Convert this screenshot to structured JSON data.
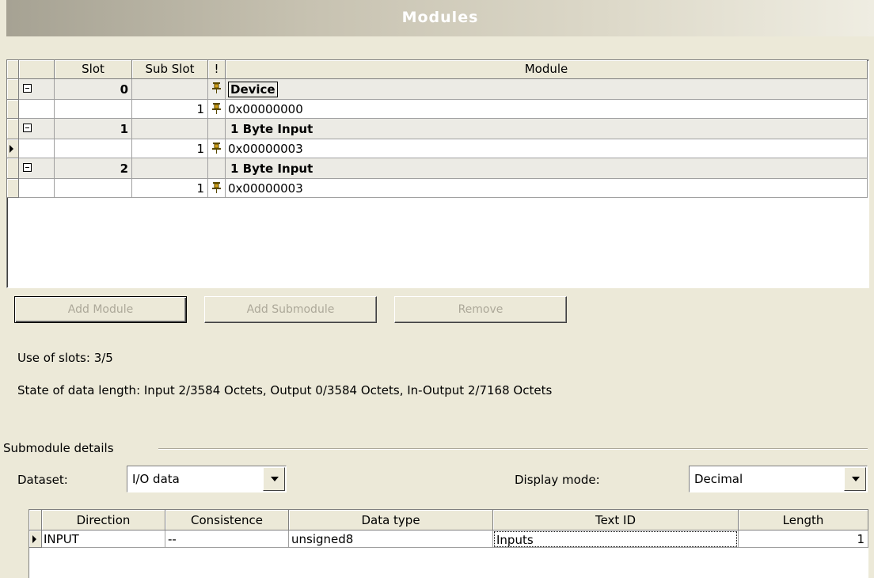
{
  "window": {
    "title": "Modules"
  },
  "modules_grid": {
    "columns": {
      "slot": "Slot",
      "sub_slot": "Sub Slot",
      "flag": "!",
      "module": "Module"
    },
    "rows": [
      {
        "type": "module",
        "slot": "0",
        "sub_slot": "",
        "pinned": true,
        "module": "Device"
      },
      {
        "type": "sub",
        "slot": "",
        "sub_slot": "1",
        "pinned": true,
        "module": "0x00000000"
      },
      {
        "type": "module",
        "slot": "1",
        "sub_slot": "",
        "pinned": false,
        "module": "1 Byte Input"
      },
      {
        "type": "sub",
        "slot": "",
        "sub_slot": "1",
        "pinned": true,
        "module": "0x00000003",
        "current": true
      },
      {
        "type": "module",
        "slot": "2",
        "sub_slot": "",
        "pinned": false,
        "module": "1 Byte Input"
      },
      {
        "type": "sub",
        "slot": "",
        "sub_slot": "1",
        "pinned": true,
        "module": "0x00000003"
      }
    ]
  },
  "buttons": {
    "add_module": "Add Module",
    "add_submodule": "Add Submodule",
    "remove": "Remove"
  },
  "status": {
    "slots": "Use of slots: 3/5",
    "data_length": "State of data length: Input 2/3584 Octets, Output 0/3584 Octets, In-Output 2/7168 Octets"
  },
  "details": {
    "group_label": "Submodule details",
    "dataset_label": "Dataset:",
    "dataset_value": "I/O data",
    "display_mode_label": "Display mode:",
    "display_mode_value": "Decimal",
    "columns": {
      "direction": "Direction",
      "consistence": "Consistence",
      "data_type": "Data type",
      "text_id": "Text ID",
      "length": "Length"
    },
    "rows": [
      {
        "direction": "INPUT",
        "consistence": "--",
        "data_type": "unsigned8",
        "text_id": "Inputs",
        "length": "1"
      }
    ]
  },
  "colors": {
    "pin": "#d4a017",
    "disabled_text": "#aca899",
    "window_bg": "#ece9d8"
  }
}
